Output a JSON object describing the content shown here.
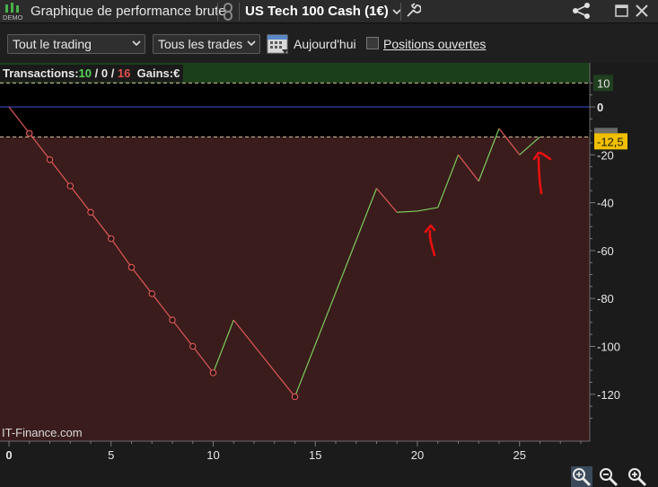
{
  "titlebar": {
    "demo_label": "DEMO",
    "title": "Graphique de performance brute",
    "instrument": "US Tech 100 Cash (1€)"
  },
  "toolbar": {
    "scope_select": "Tout le trading",
    "trades_select": "Tous les trades",
    "today_label": "Aujourd'hui",
    "open_positions_label": "Positions ouvertes",
    "open_positions_checked": false
  },
  "stats": {
    "transactions_label": "Transactions:",
    "winners": "10",
    "separator1": " / ",
    "neutral": "0",
    "separator2": " / ",
    "losers": "16",
    "gains_label": "Gains:",
    "gains_unit": "€"
  },
  "watermark": "IT-Finance.com",
  "colors": {
    "profit_zone": "#1b3f1b",
    "loss_zone": "#3a1c1c",
    "zero_line": "#3a4fd8",
    "marker_line": "#d9c3a0",
    "up_segment": "#7ccc5c",
    "down_segment": "#e05858",
    "current_label_bg": "#f0c000",
    "annotation": "#e81010"
  },
  "chart_data": {
    "type": "line",
    "x_label": "",
    "y_label": "",
    "xlim": [
      0,
      28
    ],
    "ylim": [
      -135,
      15
    ],
    "x_ticks": [
      "0",
      "5",
      "10",
      "15",
      "20",
      "25"
    ],
    "y_ticks": [
      "10",
      "0",
      "-20",
      "-40",
      "-60",
      "-80",
      "-100",
      "-120"
    ],
    "highlighted_y_tick": "0",
    "upper_marker": {
      "value": 10,
      "label": "10"
    },
    "current_marker": {
      "value": -12.5,
      "label": "-12,5"
    },
    "x": [
      0,
      1,
      2,
      3,
      4,
      5,
      6,
      7,
      8,
      9,
      10,
      11,
      14,
      18,
      19,
      20,
      21,
      22,
      23,
      24,
      25,
      26
    ],
    "y": [
      0,
      -11,
      -22,
      -33,
      -44,
      -55,
      -67,
      -78,
      -89,
      -100,
      -111,
      -89,
      -121,
      -34,
      -44,
      -43.5,
      -42,
      -20,
      -31,
      -9,
      -20,
      -12.5
    ],
    "markers_x": [
      1,
      2,
      3,
      4,
      5,
      6,
      7,
      8,
      9,
      10,
      14
    ]
  }
}
